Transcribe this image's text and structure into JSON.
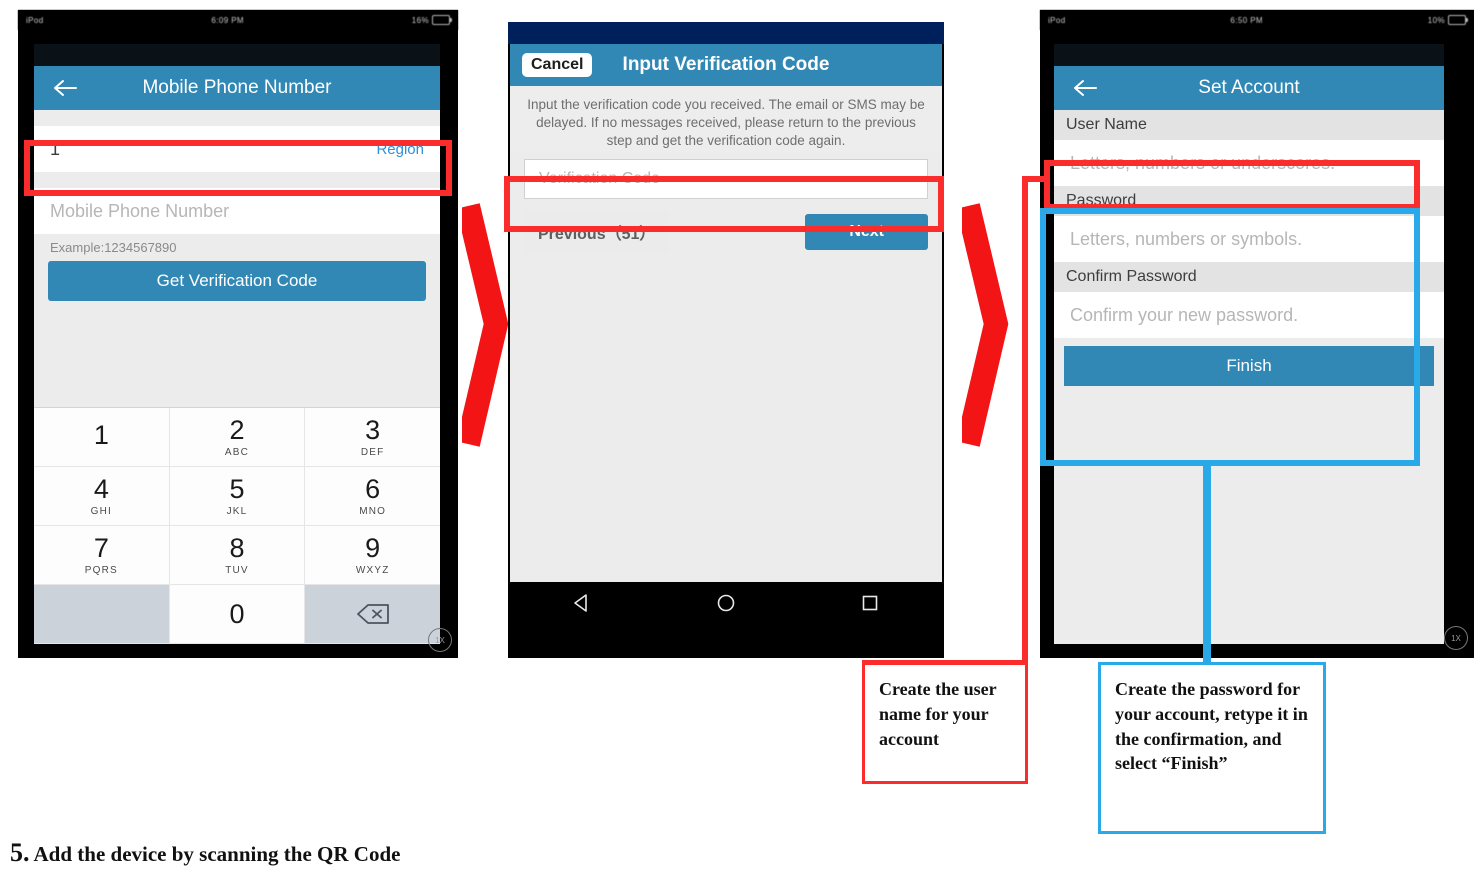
{
  "caption": {
    "number": "5.",
    "text": "Add the device by scanning the QR Code"
  },
  "phone1": {
    "status": {
      "carrier": "iPod",
      "time": "6:09 PM",
      "battery": "16%"
    },
    "nav": {
      "title": "Mobile Phone Number",
      "back_icon": "back-arrow-icon"
    },
    "country_code": "1",
    "region_label": "Region",
    "phone_placeholder": "Mobile Phone Number",
    "example_hint": "Example:1234567890",
    "get_code_button": "Get Verification Code",
    "keyboard": [
      {
        "num": "1",
        "sub": ""
      },
      {
        "num": "2",
        "sub": "ABC"
      },
      {
        "num": "3",
        "sub": "DEF"
      },
      {
        "num": "4",
        "sub": "GHI"
      },
      {
        "num": "5",
        "sub": "JKL"
      },
      {
        "num": "6",
        "sub": "MNO"
      },
      {
        "num": "7",
        "sub": "PQRS"
      },
      {
        "num": "8",
        "sub": "TUV"
      },
      {
        "num": "9",
        "sub": "WXYZ"
      },
      {
        "num": "",
        "sub": ""
      },
      {
        "num": "0",
        "sub": ""
      },
      {
        "num": "",
        "sub": "",
        "icon": "backspace-icon"
      }
    ],
    "zoom_badge": "1X"
  },
  "phone2": {
    "nav": {
      "cancel_label": "Cancel",
      "title": "Input Verification Code"
    },
    "description": "Input the verification code you received. The email or SMS may be delayed. If no messages received, please return to the previous step and get the verification code again.",
    "code_placeholder": "Verification Code",
    "previous_button": "Previous（51）",
    "next_button": "Next",
    "android_nav": [
      "back-triangle-icon",
      "home-circle-icon",
      "recents-square-icon"
    ]
  },
  "phone3": {
    "status": {
      "carrier": "iPod",
      "time": "6:50 PM",
      "battery": "10%"
    },
    "nav": {
      "title": "Set Account",
      "back_icon": "back-arrow-icon"
    },
    "username_label": "User Name",
    "username_placeholder": "Letters, numbers or underscores.",
    "password_label": "Password",
    "password_placeholder": "Letters, numbers or symbols.",
    "confirm_label": "Confirm Password",
    "confirm_placeholder": "Confirm your new password.",
    "finish_button": "Finish",
    "zoom_badge": "1X"
  },
  "callouts": {
    "username": "Create the user name for your account",
    "password": "Create the password for your account, retype it in the confirmation, and select “Finish”"
  },
  "colors": {
    "accent_blue": "#3288b5",
    "highlight_red": "#fb2c2c",
    "highlight_blue": "#29a9e8",
    "link_blue": "#2f8fd8"
  }
}
